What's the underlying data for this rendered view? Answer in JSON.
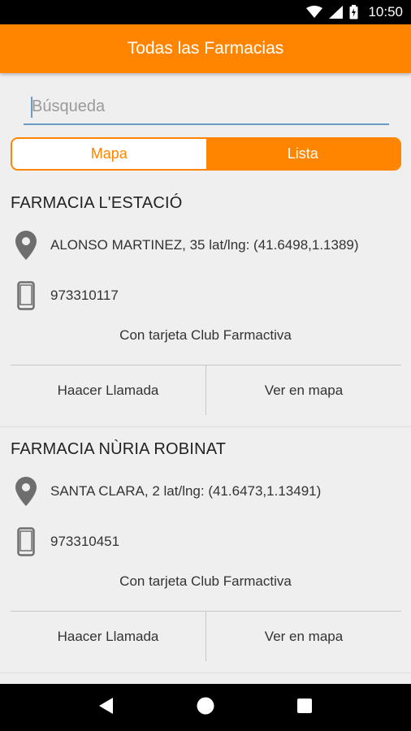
{
  "status_bar": {
    "time": "10:50",
    "icons": [
      "wifi-icon",
      "signal-icon",
      "battery-icon"
    ]
  },
  "app_bar": {
    "title": "Todas las Farmacias",
    "color": "#ff8500"
  },
  "search": {
    "placeholder": "Búsqueda",
    "value": ""
  },
  "view_toggle": {
    "options": [
      "Mapa",
      "Lista"
    ],
    "selected": "Lista"
  },
  "pharmacies": [
    {
      "name": "FARMACIA L'ESTACIÓ",
      "address": "ALONSO MARTINEZ, 35 lat/lng: (41.6498,1.1389)",
      "phone": "973310117",
      "club": "Con tarjeta Club Farmactiva",
      "call_label": "Haacer Llamada",
      "map_label": "Ver en mapa"
    },
    {
      "name": "FARMACIA NÙRIA ROBINAT",
      "address": "SANTA CLARA, 2 lat/lng: (41.6473,1.13491)",
      "phone": "973310451",
      "club": "Con tarjeta Club Farmactiva",
      "call_label": "Haacer Llamada",
      "map_label": "Ver en mapa"
    }
  ],
  "nav_bar": {
    "buttons": [
      "back-icon",
      "home-icon",
      "recents-icon"
    ]
  }
}
